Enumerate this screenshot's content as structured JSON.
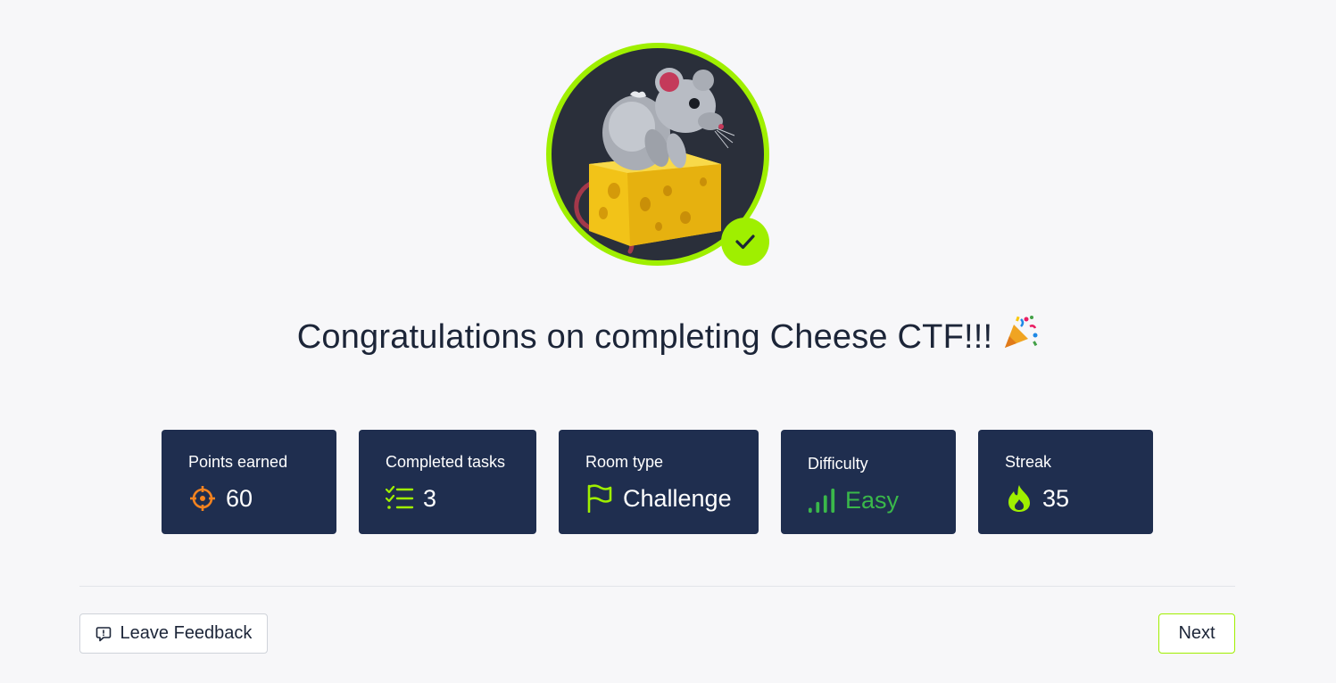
{
  "title": "Congratulations on completing Cheese CTF!!!",
  "stats": [
    {
      "label": "Points earned",
      "value": "60",
      "icon": "crosshair-icon",
      "icon_color": "#f5831f"
    },
    {
      "label": "Completed tasks",
      "value": "3",
      "icon": "checklist-icon",
      "icon_color": "#9fef00"
    },
    {
      "label": "Room type",
      "value": "Challenge",
      "icon": "flag-icon",
      "icon_color": "#9fef00"
    },
    {
      "label": "Difficulty",
      "value": "Easy",
      "icon": "signal-bars-icon",
      "icon_color": "#3ab84a"
    },
    {
      "label": "Streak",
      "value": "35",
      "icon": "flame-icon",
      "icon_color": "#9fef00"
    }
  ],
  "footer": {
    "feedback_label": "Leave Feedback",
    "next_label": "Next"
  },
  "colors": {
    "accent": "#9fef00",
    "card_bg": "#1f2e4f",
    "page_bg": "#f7f7f9"
  }
}
